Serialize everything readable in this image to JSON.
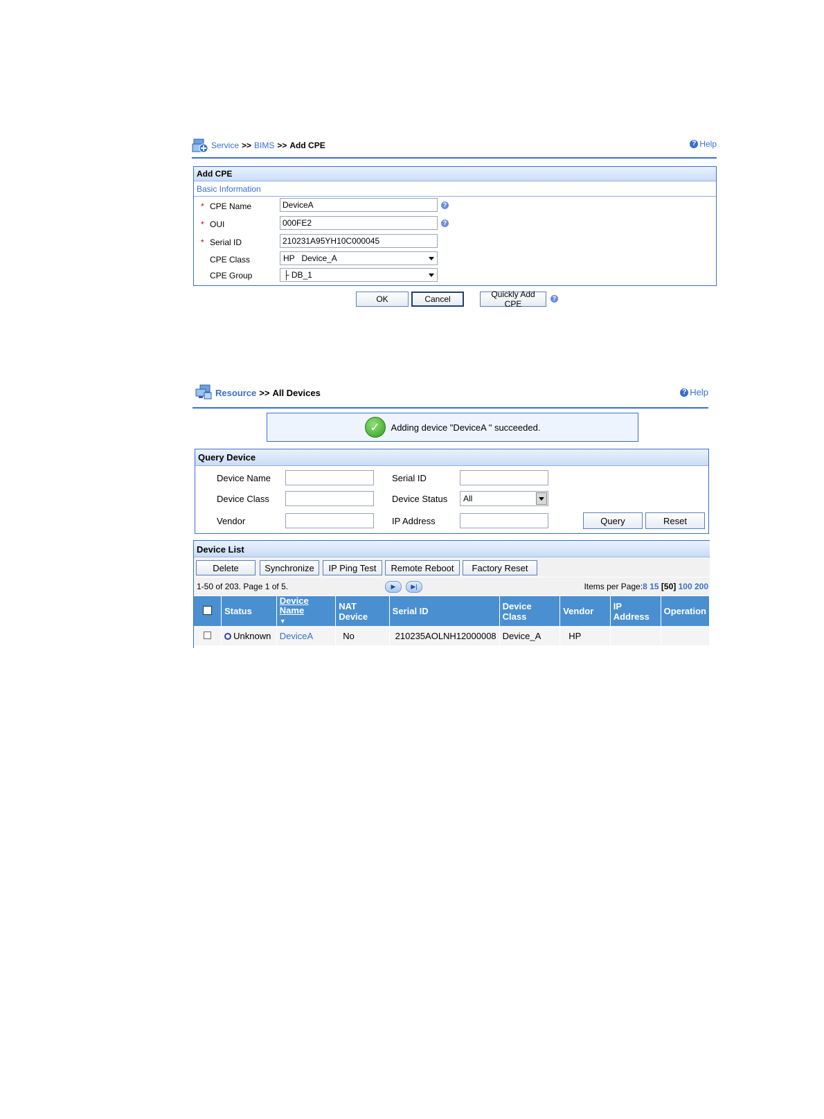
{
  "add_cpe": {
    "breadcrumb": {
      "service": "Service",
      "sep1": ">>",
      "bims": "BIMS",
      "sep2": ">>",
      "current": "Add CPE"
    },
    "help": "Help",
    "panel_title": "Add CPE",
    "section_title": "Basic Information",
    "required_mark": "*",
    "fields": {
      "cpe_name": {
        "label": "CPE Name",
        "value": "DeviceA"
      },
      "oui": {
        "label": "OUI",
        "value": "000FE2"
      },
      "serial_id": {
        "label": "Serial ID",
        "value": "210231A95YH10C000045"
      },
      "cpe_class": {
        "label": "CPE Class",
        "value": "HP   Device_A"
      },
      "cpe_group": {
        "label": "CPE Group",
        "value": "├ DB_1"
      }
    },
    "buttons": {
      "ok": "OK",
      "cancel": "Cancel",
      "quick_add": "Quickly Add CPE"
    }
  },
  "all_devices": {
    "breadcrumb": {
      "resource": "Resource",
      "sep": ">>",
      "current": "All Devices"
    },
    "help": "Help",
    "success_message": "Adding device \"DeviceA \" succeeded.",
    "query": {
      "title": "Query Device",
      "device_name": {
        "label": "Device Name",
        "value": ""
      },
      "serial_id": {
        "label": "Serial ID",
        "value": ""
      },
      "device_class": {
        "label": "Device Class",
        "value": ""
      },
      "device_status": {
        "label": "Device Status",
        "value": "All"
      },
      "vendor": {
        "label": "Vendor",
        "value": ""
      },
      "ip_address": {
        "label": "IP Address",
        "value": ""
      },
      "query_button": "Query",
      "reset_button": "Reset"
    },
    "device_list": {
      "title": "Device List",
      "toolbar": {
        "delete": "Delete",
        "synchronize": "Synchronize",
        "ip_ping": "IP Ping Test",
        "remote_reboot": "Remote Reboot",
        "factory_reset": "Factory Reset"
      },
      "pager": {
        "summary": "1-50 of 203. Page 1 of 5.",
        "items_per_page_label": "Items per Page:",
        "option_8": "8",
        "option_15": "15",
        "option_50": "[50]",
        "option_100": "100",
        "option_200": "200"
      },
      "columns": {
        "status": "Status",
        "device_name": "Device Name",
        "nat_device": "NAT Device",
        "serial_id": "Serial ID",
        "device_class": "Device Class",
        "vendor": "Vendor",
        "ip_address": "IP Address",
        "operation": "Operation"
      },
      "rows": [
        {
          "status": "Unknown",
          "device_name": "DeviceA",
          "nat_device": "No",
          "serial_id": "210235AOLNH12000008",
          "device_class": "Device_A",
          "vendor": "HP",
          "ip_address": "",
          "operation": ""
        }
      ]
    }
  }
}
